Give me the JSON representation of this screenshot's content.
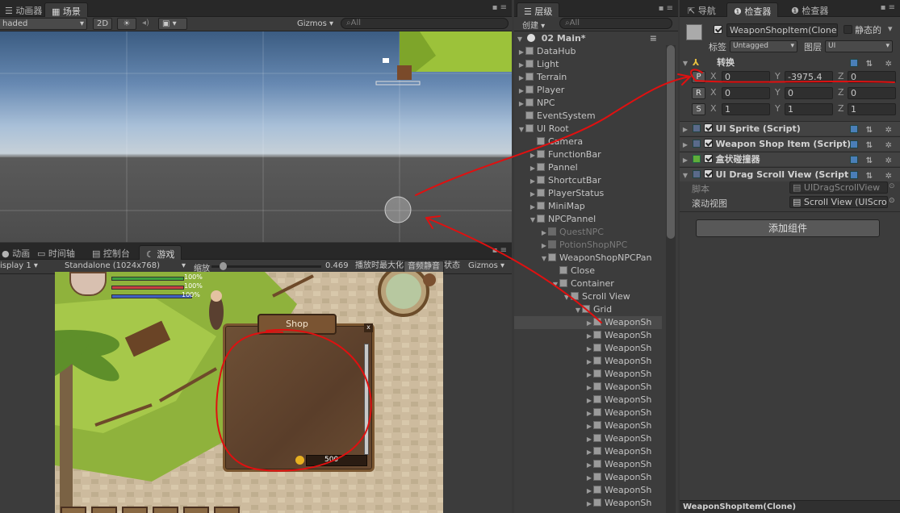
{
  "scene": {
    "tabs": [
      "动画器",
      "场景"
    ],
    "shading": "haded",
    "mode_2d": "2D",
    "sun_icon": "sun-icon",
    "audio_icon": "audio-icon",
    "image_icon": "image-icon",
    "gizmos": "Gizmos",
    "search_placeholder": "All"
  },
  "game": {
    "tabs": [
      "动画",
      "时间轴",
      "控制台",
      "游戏"
    ],
    "display": "isplay 1",
    "resolution": "Standalone (1024x768)",
    "scale_label": "缩放",
    "scale_value": "0.469",
    "maximize": "播放时最大化",
    "mute": "音频静音",
    "stats": "状态",
    "gizmos": "Gizmos",
    "hud": {
      "hp": "100%",
      "mp": "100%",
      "exp": "100%"
    },
    "shop": {
      "title": "Shop",
      "close": "x",
      "coins": "500"
    }
  },
  "hierarchy": {
    "tab": "层级",
    "create": "创建",
    "search_placeholder": "All",
    "scene_name": "02 Main*",
    "rows": [
      {
        "label": "DataHub",
        "indent": 1,
        "arrow": "▶",
        "style": ""
      },
      {
        "label": "Light",
        "indent": 1,
        "arrow": "▶",
        "style": ""
      },
      {
        "label": "Terrain",
        "indent": 1,
        "arrow": "▶",
        "style": ""
      },
      {
        "label": "Player",
        "indent": 1,
        "arrow": "▶",
        "style": ""
      },
      {
        "label": "NPC",
        "indent": 1,
        "arrow": "▶",
        "style": ""
      },
      {
        "label": "EventSystem",
        "indent": 1,
        "arrow": "",
        "style": ""
      },
      {
        "label": "UI Root",
        "indent": 1,
        "arrow": "▼",
        "style": ""
      },
      {
        "label": "Camera",
        "indent": 2,
        "arrow": "",
        "style": ""
      },
      {
        "label": "FunctionBar",
        "indent": 2,
        "arrow": "▶",
        "style": ""
      },
      {
        "label": "Pannel",
        "indent": 2,
        "arrow": "▶",
        "style": ""
      },
      {
        "label": "ShortcutBar",
        "indent": 2,
        "arrow": "▶",
        "style": ""
      },
      {
        "label": "PlayerStatus",
        "indent": 2,
        "arrow": "▶",
        "style": ""
      },
      {
        "label": "MiniMap",
        "indent": 2,
        "arrow": "▶",
        "style": ""
      },
      {
        "label": "NPCPannel",
        "indent": 2,
        "arrow": "▼",
        "style": ""
      },
      {
        "label": "QuestNPC",
        "indent": 3,
        "arrow": "▶",
        "style": "dim"
      },
      {
        "label": "PotionShopNPC",
        "indent": 3,
        "arrow": "▶",
        "style": "dim"
      },
      {
        "label": "WeaponShopNPCPan",
        "indent": 3,
        "arrow": "▼",
        "style": ""
      },
      {
        "label": "Close",
        "indent": 4,
        "arrow": "",
        "style": ""
      },
      {
        "label": "Container",
        "indent": 4,
        "arrow": "▼",
        "style": ""
      },
      {
        "label": "Scroll View",
        "indent": 5,
        "arrow": "▼",
        "style": ""
      },
      {
        "label": "Grid",
        "indent": 6,
        "arrow": "▼",
        "style": ""
      },
      {
        "label": "WeaponSh",
        "indent": 7,
        "arrow": "▶",
        "style": "sel"
      },
      {
        "label": "WeaponSh",
        "indent": 7,
        "arrow": "▶",
        "style": ""
      },
      {
        "label": "WeaponSh",
        "indent": 7,
        "arrow": "▶",
        "style": ""
      },
      {
        "label": "WeaponSh",
        "indent": 7,
        "arrow": "▶",
        "style": ""
      },
      {
        "label": "WeaponSh",
        "indent": 7,
        "arrow": "▶",
        "style": ""
      },
      {
        "label": "WeaponSh",
        "indent": 7,
        "arrow": "▶",
        "style": ""
      },
      {
        "label": "WeaponSh",
        "indent": 7,
        "arrow": "▶",
        "style": ""
      },
      {
        "label": "WeaponSh",
        "indent": 7,
        "arrow": "▶",
        "style": ""
      },
      {
        "label": "WeaponSh",
        "indent": 7,
        "arrow": "▶",
        "style": ""
      },
      {
        "label": "WeaponSh",
        "indent": 7,
        "arrow": "▶",
        "style": ""
      },
      {
        "label": "WeaponSh",
        "indent": 7,
        "arrow": "▶",
        "style": ""
      },
      {
        "label": "WeaponSh",
        "indent": 7,
        "arrow": "▶",
        "style": ""
      },
      {
        "label": "WeaponSh",
        "indent": 7,
        "arrow": "▶",
        "style": ""
      },
      {
        "label": "WeaponSh",
        "indent": 7,
        "arrow": "▶",
        "style": ""
      },
      {
        "label": "WeaponSh",
        "indent": 7,
        "arrow": "▶",
        "style": ""
      }
    ]
  },
  "inspector": {
    "tabs": [
      "导航",
      "检查器",
      "检查器"
    ],
    "object_name": "WeaponShopItem(Clone)",
    "static_label": "静态的",
    "tag_label": "标签",
    "tag_value": "Untagged",
    "layer_label": "图层",
    "layer_value": "UI",
    "transform": {
      "title": "转换",
      "position": {
        "btn": "P",
        "x": "0",
        "y": "-3975.4",
        "z": "0"
      },
      "rotation": {
        "btn": "R",
        "x": "0",
        "y": "0",
        "z": "0"
      },
      "scale": {
        "btn": "S",
        "x": "1",
        "y": "1",
        "z": "1"
      }
    },
    "axis": {
      "x": "X",
      "y": "Y",
      "z": "Z"
    },
    "components": [
      {
        "title": "UI Sprite (Script)"
      },
      {
        "title": "Weapon Shop Item (Script)"
      },
      {
        "title": "盒状碰撞器"
      },
      {
        "title": "UI Drag Scroll View (Script"
      }
    ],
    "script_label": "脚本",
    "script_value": "UIDragScrollView",
    "scrollview_label": "滚动视图",
    "scrollview_value": "Scroll View (UIScro",
    "add_component": "添加组件",
    "footer": "WeaponShopItem(Clone)"
  },
  "colors": {
    "annotation": "#e01010",
    "selection": "#4a4a4a"
  }
}
